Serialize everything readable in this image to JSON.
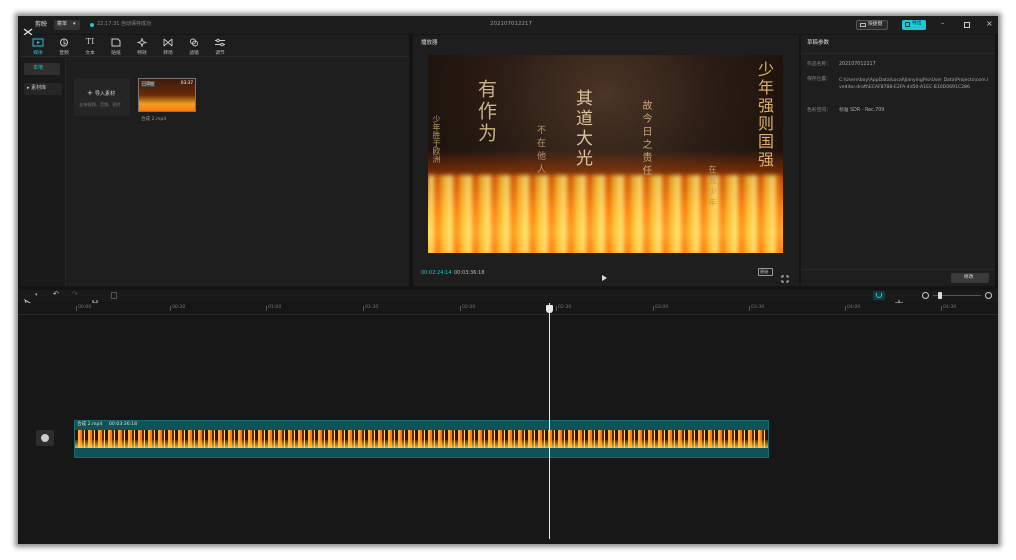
{
  "app": {
    "name": "剪映",
    "menu_label": "菜单",
    "save_status": "22:17:31 自动保存成功",
    "project_title": "202107012217",
    "shortcut_label": "快捷键",
    "export_label": "导出"
  },
  "toolbar": {
    "items": [
      {
        "label": "媒体",
        "icon": "media-icon",
        "active": true
      },
      {
        "label": "音频",
        "icon": "audio-icon"
      },
      {
        "label": "文本",
        "icon": "text-icon"
      },
      {
        "label": "贴纸",
        "icon": "sticker-icon"
      },
      {
        "label": "特效",
        "icon": "effects-icon"
      },
      {
        "label": "转场",
        "icon": "transition-icon"
      },
      {
        "label": "滤镜",
        "icon": "filter-icon"
      },
      {
        "label": "调节",
        "icon": "adjust-icon"
      }
    ]
  },
  "sidebar": {
    "items": [
      {
        "label": "本地",
        "active": true
      },
      {
        "label": "▸ 素材库"
      }
    ]
  },
  "media": {
    "import_label": "导入素材",
    "import_hint": "支持视频、音频、图片",
    "clip_duration": "03:37",
    "clip_badge": "已添加",
    "clip_name": "合成 2.mp4"
  },
  "player": {
    "title": "播放器",
    "current_time": "00:02:24:14",
    "total_time": "00:03:36:18",
    "ratio_label": "原始"
  },
  "draft": {
    "title": "草稿参数",
    "name_label": "作品名称：",
    "name_value": "202107012217",
    "path_label": "保存位置：",
    "path_value": "C:\\Users\\boy\\AppData\\Local\\JianyingPro\\User Data\\Projects\\com.lveditor.draft\\ECAF8788-E2FA-4d50-A1EC-B10D0691C286",
    "color_label": "色彩空间：",
    "color_value": "标准 SDR - Rec.709",
    "edit_label": "修改"
  },
  "timeline": {
    "ticks": [
      "00:00",
      "00:30",
      "01:00",
      "01:30",
      "02:00",
      "02:30",
      "03:00",
      "03:30",
      "04:00",
      "04:30"
    ],
    "clip_label": "合成 2.mp4",
    "clip_duration": "00:03:36:18"
  },
  "poem": {
    "line1": "有作为",
    "line2": "其道大光",
    "line3": "少年强则国强",
    "side1": "少年胜于欧洲",
    "side2": "不在他人",
    "side3": "故今日之责任",
    "side4": "在我少年"
  },
  "colors": {
    "accent": "#1ec8d8",
    "clip_fill": "#0f5257",
    "bg": "#141414",
    "panel": "#1e1e1e"
  }
}
